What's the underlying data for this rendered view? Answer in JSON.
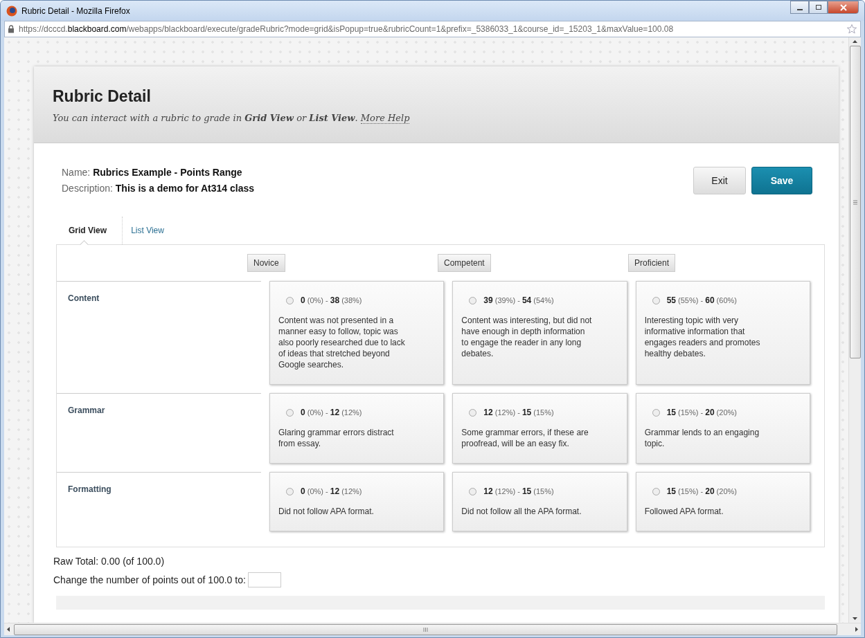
{
  "window": {
    "title": "Rubric Detail - Mozilla Firefox"
  },
  "address_bar": {
    "url": "https://dcccd.**blackboard.com**/webapps/blackboard/execute/gradeRubric?mode=grid&isPopup=true&rubricCount=1&prefix=_5386033_1&course_id=_15203_1&maxValue=100.08"
  },
  "header": {
    "title": "Rubric Detail",
    "intro": "You can interact with a rubric to grade in **Grid View** or **List View**.",
    "help_link": "More Help"
  },
  "details": {
    "name_label": "Name:",
    "name": "Rubrics Example - Points Range",
    "description_label": "Description:",
    "description": "This is a demo for At314 class"
  },
  "buttons": [
    {
      "label": "Exit",
      "kind": "secondary"
    },
    {
      "label": "Save",
      "kind": "primary"
    }
  ],
  "tabs": [
    {
      "label": "Grid View",
      "selected": true
    },
    {
      "label": "List View",
      "selected": false
    }
  ],
  "rubric": {
    "levels": [
      "Novice",
      "Competent",
      "Proficient"
    ],
    "criteria": [
      {
        "name": "Content",
        "cells": [
          {
            "range": "**0** (0%) - **38** (38%)",
            "selected": false,
            "text": "Content was not presented in a manner easy to follow, topic was also poorly researched due to lack of ideas that stretched beyond Google searches."
          },
          {
            "range": "**39** (39%) - **54** (54%)",
            "selected": false,
            "text": "Content was interesting, but did not have enough in depth information to engage the reader in any long debates."
          },
          {
            "range": "**55** (55%) - **60** (60%)",
            "selected": false,
            "text": "Interesting topic with very informative information that engages readers and promotes healthy debates."
          }
        ]
      },
      {
        "name": "Grammar",
        "cells": [
          {
            "range": "**0** (0%) - **12** (12%)",
            "selected": false,
            "text": "Glaring grammar errors distract from essay."
          },
          {
            "range": "**12** (12%) - **15** (15%)",
            "selected": false,
            "text": "Some grammar errors, if these are proofread, will be an easy fix."
          },
          {
            "range": "**15** (15%) - **20** (20%)",
            "selected": false,
            "text": "Grammar lends to an engaging topic."
          }
        ]
      },
      {
        "name": "Formatting",
        "cells": [
          {
            "range": "**0** (0%) - **12** (12%)",
            "selected": false,
            "text": "Did not follow APA format."
          },
          {
            "range": "**12** (12%) - **15** (15%)",
            "selected": false,
            "text": "Did not follow all the APA format."
          },
          {
            "range": "**15** (15%) - **20** (20%)",
            "selected": false,
            "text": "Followed APA format."
          }
        ]
      }
    ]
  },
  "totals": {
    "raw_total": "Raw Total: 0.00 (of 100.0)",
    "change_points_label": "Change the number of points out of 100.0 to:"
  }
}
